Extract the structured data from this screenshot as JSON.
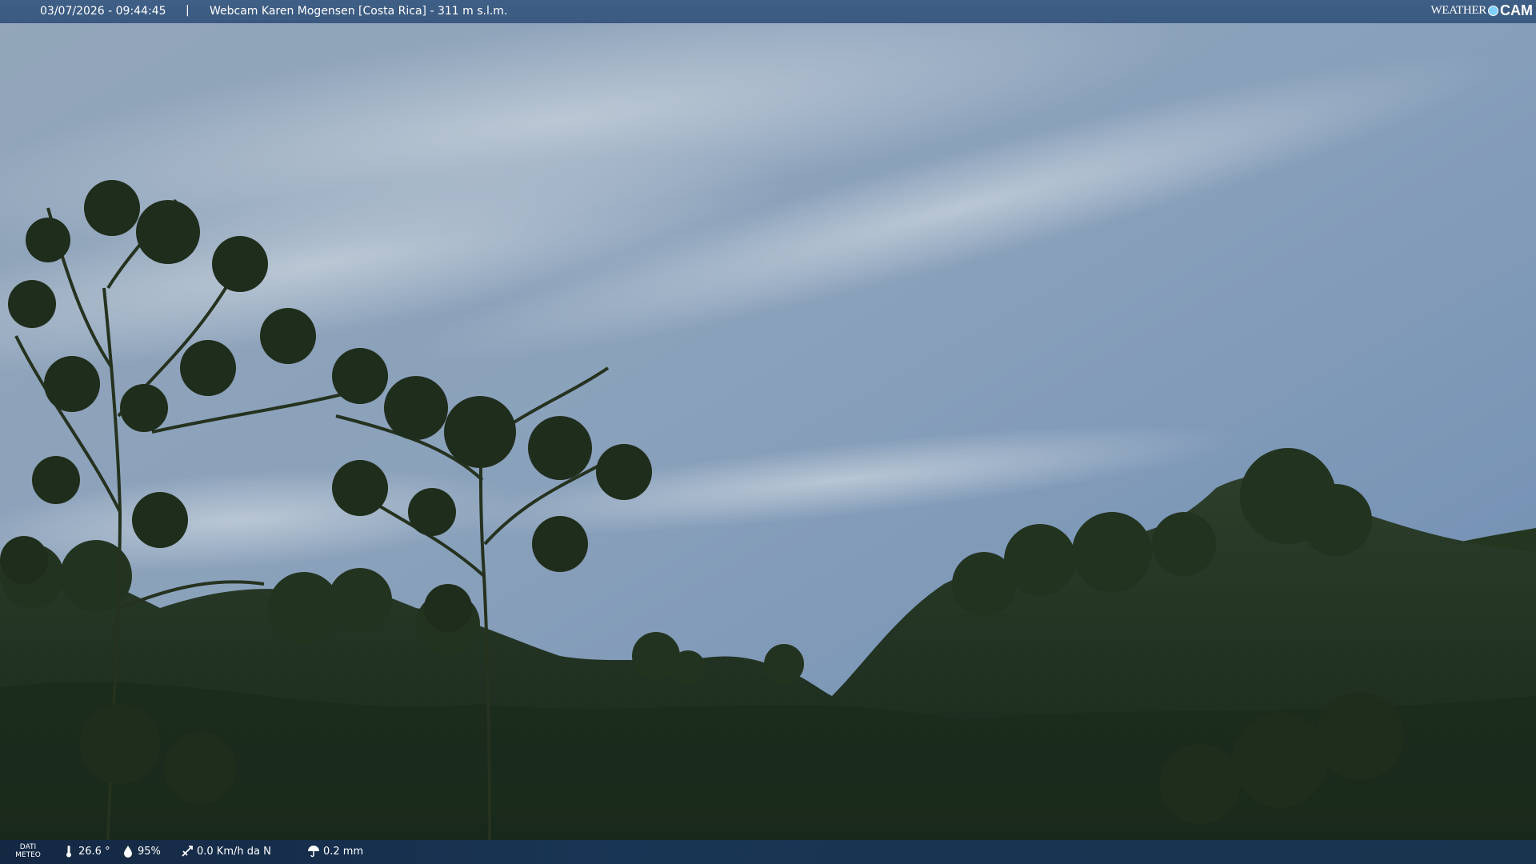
{
  "header": {
    "timestamp": "03/07/2026 - 09:44:45",
    "separator": "|",
    "title": "Webcam Karen Mogensen [Costa Rica]  - 311 m s.l.m.",
    "logo_word": "WEATHER",
    "logo_cam": "CAM"
  },
  "footer": {
    "label_line1": "DATI",
    "label_line2": "METEO",
    "temperature": "26.6 °",
    "temperature_icon": "thermometer-icon",
    "humidity": "95%",
    "humidity_icon": "humidity-drop-icon",
    "wind": "0.0 Km/h da N",
    "wind_icon": "wind-vane-icon",
    "rain": "0.2 mm",
    "rain_icon": "umbrella-icon"
  },
  "colors": {
    "sky_top": "#8fa3b8",
    "sky_mid": "#7f9ab9",
    "foliage": "#1c2d1e",
    "bar": "#3d5d84"
  }
}
